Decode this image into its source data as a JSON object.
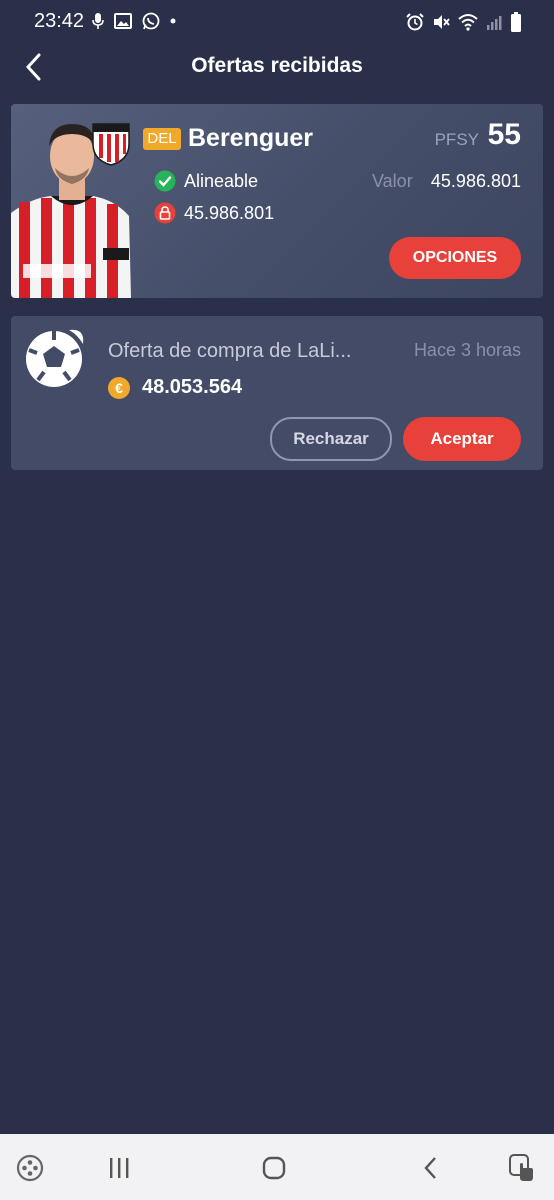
{
  "status_bar": {
    "time": "23:42",
    "left_icons": [
      "mic-icon",
      "image-icon",
      "whatsapp-icon",
      "dot-icon"
    ],
    "right_icons": [
      "alarm-icon",
      "mute-icon",
      "wifi-icon",
      "signal-icon",
      "battery-icon"
    ]
  },
  "appbar": {
    "title": "Ofertas recibidas"
  },
  "player": {
    "position": "DEL",
    "name": "Berenguer",
    "pfsy_label": "PFSY",
    "pfsy_value": "55",
    "status": "Alineable",
    "clause": "45.986.801",
    "valor_label": "Valor",
    "valor_value": "45.986.801",
    "options_label": "OPCIONES"
  },
  "offer": {
    "title": "Oferta de compra de LaLi...",
    "time": "Hace 3 horas",
    "amount": "48.053.564",
    "currency_symbol": "€",
    "reject_label": "Rechazar",
    "accept_label": "Aceptar"
  },
  "colors": {
    "background": "#2a3049",
    "card": "#434b66",
    "accent_red": "#e8413a",
    "badge_orange": "#f1a92a",
    "ok_green": "#27b35a"
  }
}
